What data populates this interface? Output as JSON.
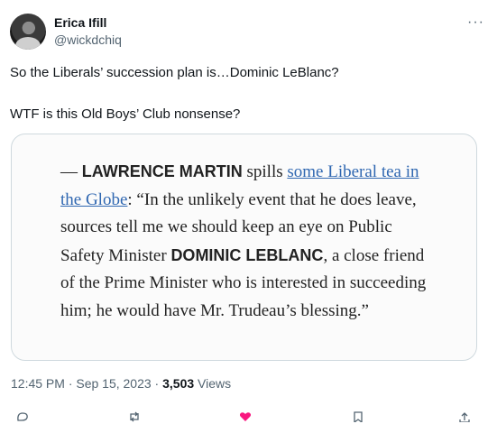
{
  "author": {
    "name": "Erica Ifill",
    "handle": "@wickdchiq"
  },
  "more_icon": "ellipsis-icon",
  "tweet": {
    "line1": "So the Liberals’ succession plan is…Dominic LeBlanc?",
    "line2": "WTF is this Old Boys’ Club nonsense?"
  },
  "quote_image": {
    "dash": "— ",
    "name1": "LAWRENCE MARTIN",
    "spills": " spills ",
    "link": "some Liberal tea in the Globe",
    "body1": ": “In the unlikely event that he does leave, sources tell me we should keep an eye on Public Safety Minister ",
    "name2": "DOMINIC LEBLANC",
    "body2": ", a close friend of the Prime Minister who is interested in succeeding him; he would have Mr. Trudeau’s blessing.”"
  },
  "meta": {
    "time_date": "12:45 PM · Sep 15, 2023 · ",
    "views_count": "3,503",
    "views_label": " Views"
  },
  "actions": [
    "reply-icon",
    "retweet-icon",
    "like-icon",
    "bookmark-icon",
    "share-icon"
  ],
  "colors": {
    "link": "#2f67b1",
    "secondary": "#536471",
    "like": "#f91880"
  }
}
